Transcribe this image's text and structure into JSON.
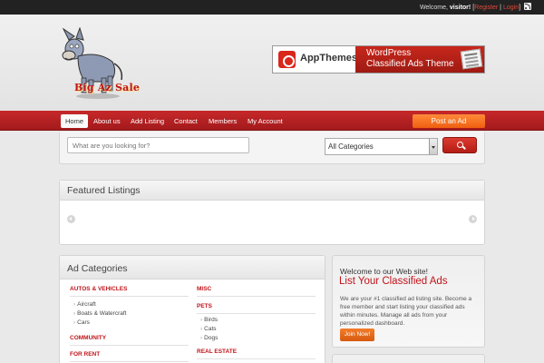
{
  "topbar": {
    "welcome_prefix": "Welcome,",
    "user": "visitor!",
    "register": "Register",
    "login": "Login",
    "sep1": "[",
    "sep2": "|",
    "sep3": "]",
    "rss_icon": "rss-icon"
  },
  "header": {
    "logo_text": "Big Az Sale",
    "banner": {
      "brand": "AppThemes",
      "line1": "WordPress",
      "line2": "Classified Ads Theme"
    }
  },
  "nav": {
    "items": [
      "Home",
      "About us",
      "Add Listing",
      "Contact",
      "Members",
      "My Account"
    ],
    "post_ad": "Post an Ad"
  },
  "search": {
    "placeholder": "What are you looking for?",
    "category": "All Categories"
  },
  "featured": {
    "title": "Featured Listings"
  },
  "ad_categories": {
    "title": "Ad Categories",
    "left": [
      {
        "name": "AUTOS & VEHICLES",
        "subs": [
          "Aircraft",
          "Boats & Watercraft",
          "Cars"
        ]
      },
      {
        "name": "COMMUNITY",
        "subs": []
      },
      {
        "name": "FOR RENT",
        "subs": []
      }
    ],
    "right": [
      {
        "name": "MISC",
        "subs": []
      },
      {
        "name": "PETS",
        "subs": [
          "Birds",
          "Cats",
          "Dogs"
        ]
      },
      {
        "name": "REAL ESTATE",
        "subs": []
      }
    ]
  },
  "welcome_box": {
    "line1": "Welcome to our Web site!",
    "title": "List Your Classified Ads",
    "text": "We are your #1 classified ad listing site. Become a free member and start listing your classified ads within minutes. Manage all ads from your personalized dashboard.",
    "button": "Join Now!"
  },
  "colors": {
    "accent": "#c0141a",
    "nav_red": "#b9211f",
    "orange": "#ef5f0e"
  }
}
